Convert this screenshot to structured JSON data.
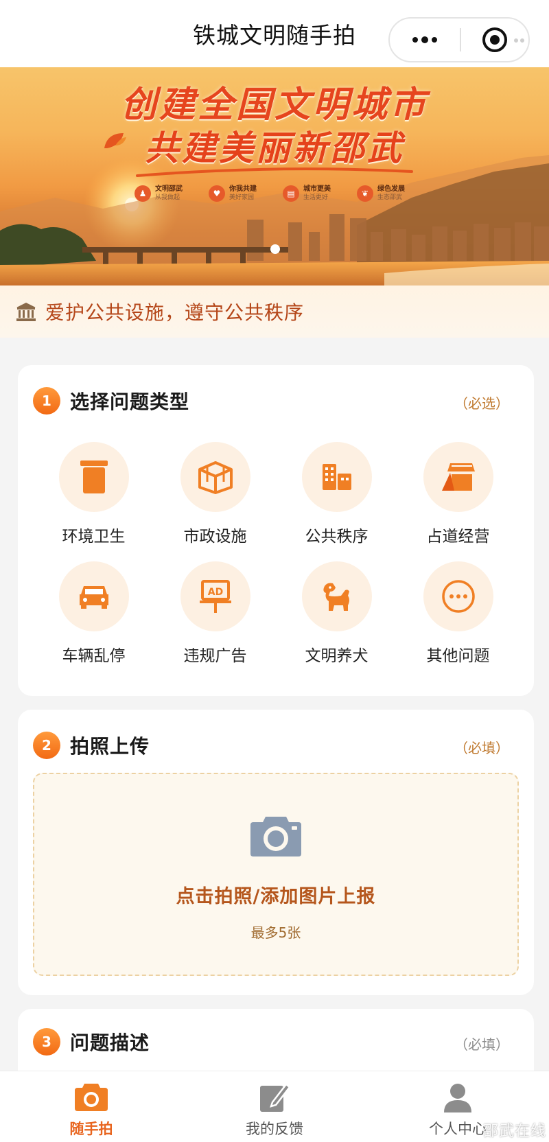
{
  "header": {
    "title": "铁城文明随手拍"
  },
  "banner": {
    "headline": "创建全国文明城市",
    "subheadline": "共建美丽新邵武",
    "features": [
      {
        "title": "文明邵武",
        "subtitle": "从我做起"
      },
      {
        "title": "你我共建",
        "subtitle": "美好家园"
      },
      {
        "title": "城市更美",
        "subtitle": "生活更好"
      },
      {
        "title": "绿色发展",
        "subtitle": "生态邵武"
      }
    ]
  },
  "slogan": {
    "text": "爱护公共设施，遵守公共秩序"
  },
  "step1": {
    "number": "1",
    "title": "选择问题类型",
    "required": "（必选）",
    "categories": [
      {
        "label": "环境卫生",
        "icon": "trash-bin-icon"
      },
      {
        "label": "市政设施",
        "icon": "municipal-facility-icon"
      },
      {
        "label": "公共秩序",
        "icon": "building-icon"
      },
      {
        "label": "占道经营",
        "icon": "street-stall-icon"
      },
      {
        "label": "车辆乱停",
        "icon": "car-icon"
      },
      {
        "label": "违规广告",
        "icon": "ad-board-icon"
      },
      {
        "label": "文明养犬",
        "icon": "dog-icon"
      },
      {
        "label": "其他问题",
        "icon": "more-dots-icon"
      }
    ]
  },
  "step2": {
    "number": "2",
    "title": "拍照上传",
    "required": "（必填）",
    "upload_label": "点击拍照/添加图片上报",
    "upload_hint": "最多5张"
  },
  "step3": {
    "number": "3",
    "title": "问题描述",
    "required": "（必填）"
  },
  "tabbar": {
    "tabs": [
      {
        "label": "随手拍",
        "active": true
      },
      {
        "label": "我的反馈",
        "active": false
      },
      {
        "label": "个人中心",
        "active": false
      }
    ]
  },
  "watermark": "邵武在线",
  "colors": {
    "accent": "#f26a14",
    "accent_light": "#fdf0e2",
    "required_text": "#c07a30"
  }
}
